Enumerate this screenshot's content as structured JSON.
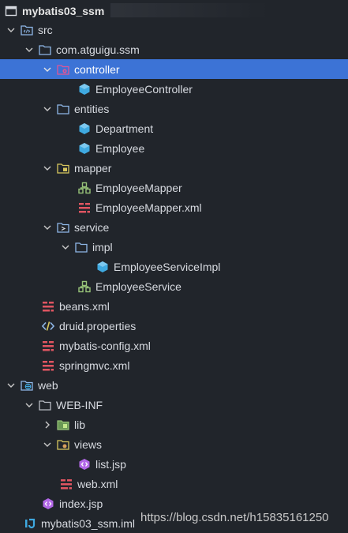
{
  "project": {
    "name": "mybatis03_ssm"
  },
  "tree": {
    "src": "src",
    "package": "com.atguigu.ssm",
    "controller": "controller",
    "employee_controller": "EmployeeController",
    "entities": "entities",
    "department": "Department",
    "employee": "Employee",
    "mapper": "mapper",
    "employee_mapper": "EmployeeMapper",
    "employee_mapper_xml": "EmployeeMapper.xml",
    "service": "service",
    "impl": "impl",
    "employee_service_impl": "EmployeeServiceImpl",
    "employee_service": "EmployeeService",
    "beans_xml": "beans.xml",
    "druid_properties": "druid.properties",
    "mybatis_config_xml": "mybatis-config.xml",
    "springmvc_xml": "springmvc.xml",
    "web": "web",
    "web_inf": "WEB-INF",
    "lib": "lib",
    "views": "views",
    "list_jsp": "list.jsp",
    "web_xml": "web.xml",
    "index_jsp": "index.jsp",
    "iml": "mybatis03_ssm.iml"
  },
  "watermark": "https://blog.csdn.net/h15835161250",
  "colors": {
    "background": "#21252b",
    "selection": "#3c73d6",
    "folder": "#8fb8e8",
    "class": "#3fa9e0",
    "xml": "#e05561",
    "interface": "#98c379"
  }
}
